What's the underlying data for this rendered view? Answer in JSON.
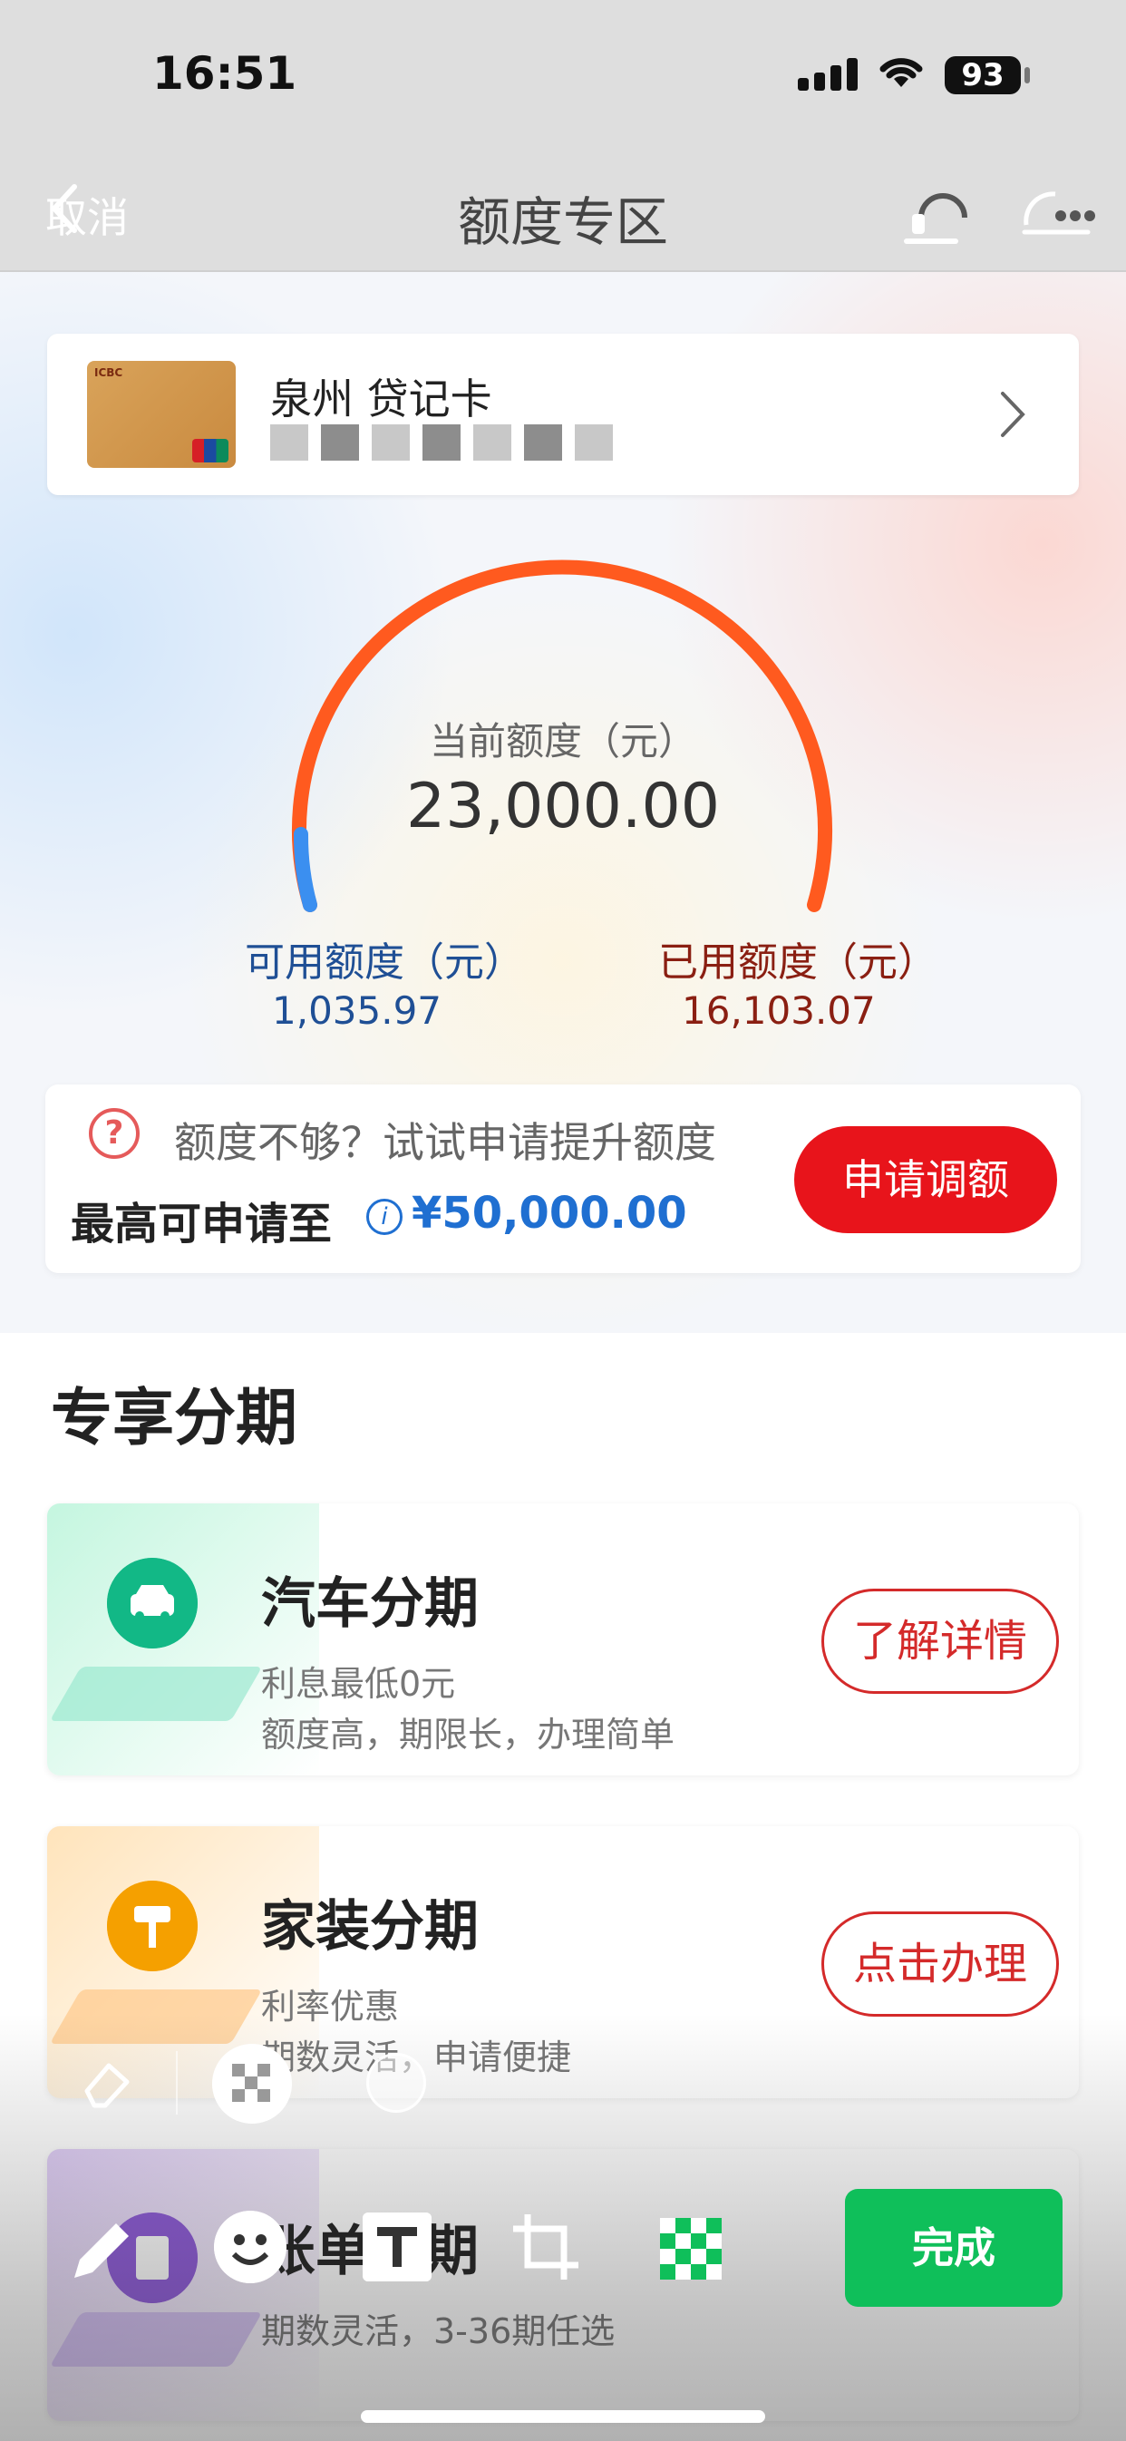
{
  "status_bar": {
    "time": "16:51",
    "battery": "93"
  },
  "nav": {
    "cancel": "取消",
    "title": "额度专区"
  },
  "card": {
    "name": "泉州 贷记卡"
  },
  "gauge": {
    "label": "当前额度（元）",
    "value": "23,000.00",
    "available_label": "可用额度（元）",
    "available_value": "1,035.97",
    "used_label": "已用额度（元）",
    "used_value": "16,103.07",
    "colors": {
      "used": "#ff5a1f",
      "available": "#3b8ff0"
    }
  },
  "raise": {
    "hint": "额度不够？试试申请提升额度",
    "max_label": "最高可申请至",
    "max_value": "¥50,000.00",
    "button": "申请调额"
  },
  "section_title": "专享分期",
  "products": [
    {
      "title": "汽车分期",
      "line1": "利息最低0元",
      "line2": "额度高，期限长，办理简单",
      "button": "了解详情"
    },
    {
      "title": "家装分期",
      "line1": "利率优惠",
      "line2": "期数灵活，申请便捷",
      "button": "点击办理"
    },
    {
      "title": "账单分期",
      "line1": "期数灵活，3-36期任选",
      "button": ""
    }
  ],
  "toolbar": {
    "done": "完成"
  },
  "icons": [
    "back-arrow-icon",
    "customer-service-icon",
    "more-icon",
    "chevron-right-icon",
    "question-icon",
    "info-icon",
    "car-icon",
    "paint-roller-icon",
    "bill-icon",
    "eraser-icon",
    "mosaic-icon",
    "blur-icon",
    "pen-icon",
    "emoji-icon",
    "text-icon",
    "crop-icon"
  ]
}
